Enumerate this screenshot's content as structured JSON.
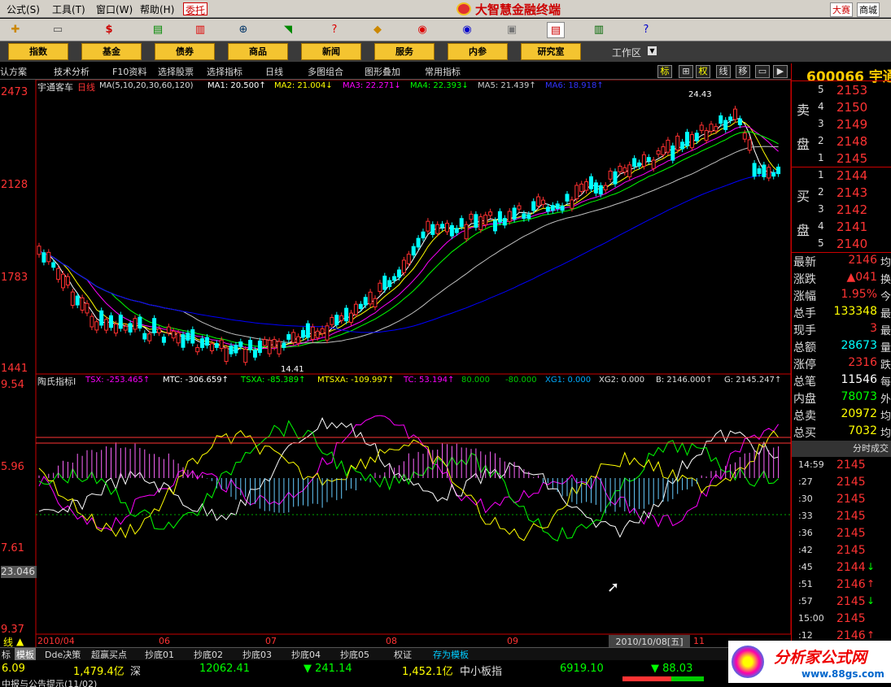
{
  "menu": {
    "items": [
      "公式(S)",
      "工具(T)",
      "窗口(W)",
      "帮助(H)"
    ],
    "entrust": "委托",
    "brand": "大智慧金融终端",
    "dasai": "大赛",
    "mall": "商城"
  },
  "nav": {
    "items": [
      "指数",
      "基金",
      "债券",
      "商品",
      "新闻",
      "服务",
      "内参",
      "研究室"
    ],
    "workarea": "工作区"
  },
  "funcbar": {
    "items": [
      "认方案",
      "技术分析",
      "F10资料",
      "选择股票",
      "选择指标",
      "日线",
      "多图组合",
      "图形叠加",
      "常用指标"
    ],
    "toggles": [
      "标",
      "权",
      "线",
      "移"
    ]
  },
  "main_chart": {
    "label": "宇通客车",
    "period": "日线",
    "ma_text": "MA(5,10,20,30,60,120)",
    "ma1": "MA1: 20.500↑",
    "ma2": "MA2: 21.004↓",
    "ma3": "MA3: 22.271↓",
    "ma4": "MA4: 22.393↓",
    "ma5": "MA5: 21.439↑",
    "ma6": "MA6: 18.918↑",
    "high_label": "24.43",
    "low_label": "14.41",
    "y_ticks": [
      "2473",
      "2128",
      "1783",
      "1441"
    ],
    "colors": {
      "up": "#ff3030",
      "down": "#00ffff",
      "ma1": "#ffffff",
      "ma2": "#ffff00",
      "ma3": "#ff00ff",
      "ma4": "#00ff00",
      "ma5": "#c0c0c0",
      "ma6": "#0000ff"
    }
  },
  "indicator": {
    "name": "陶氏指标I",
    "tsx": "TSX: -253.465↑",
    "mtc": "MTC: -306.659↑",
    "tsxa": "TSXA: -85.389↑",
    "mtsxa": "MTSXA: -109.997↑",
    "tc": "TC: 53.194↑",
    "c80": "80.000",
    "cm80": "-80.000",
    "xg1": "XG1: 0.000",
    "xg2": "XG2: 0.000",
    "b": "B: 2146.000↑",
    "g": "G: 2145.247↑",
    "y_ticks": [
      "9.54",
      "5.96",
      "7.61",
      "9.37"
    ],
    "cursor_value": "23.046"
  },
  "x_axis": [
    "2010/04",
    "06",
    "07",
    "08",
    "09",
    "11"
  ],
  "date_tip": "2010/10/08[五]",
  "line_label": "线",
  "quote": {
    "code": "600066 宇通",
    "sell_label": [
      "卖",
      "盘"
    ],
    "buy_label": [
      "买",
      "盘"
    ],
    "sell": [
      {
        "lvl": "5",
        "px": "2153"
      },
      {
        "lvl": "4",
        "px": "2150"
      },
      {
        "lvl": "3",
        "px": "2149"
      },
      {
        "lvl": "2",
        "px": "2148"
      },
      {
        "lvl": "1",
        "px": "2145"
      }
    ],
    "buy": [
      {
        "lvl": "1",
        "px": "2144"
      },
      {
        "lvl": "2",
        "px": "2143"
      },
      {
        "lvl": "3",
        "px": "2142"
      },
      {
        "lvl": "4",
        "px": "2141"
      },
      {
        "lvl": "5",
        "px": "2140"
      }
    ],
    "stats": [
      {
        "label": "最新",
        "value": "2146",
        "color": "#ff3333",
        "tail": "均"
      },
      {
        "label": "涨跌",
        "value": "▲041",
        "color": "#ff3333",
        "tail": "换"
      },
      {
        "label": "涨幅",
        "value": "1.95%",
        "color": "#ff3333",
        "tail": "今"
      },
      {
        "label": "总手",
        "value": "133348",
        "color": "#ffff00",
        "tail": "最"
      },
      {
        "label": "现手",
        "value": "3",
        "color": "#ff3333",
        "tail": "最"
      },
      {
        "label": "总额",
        "value": "28673",
        "color": "#00ffff",
        "tail": "量"
      },
      {
        "label": "涨停",
        "value": "2316",
        "color": "#ff3333",
        "tail": "跌"
      },
      {
        "label": "总笔",
        "value": "11546",
        "color": "#ffffff",
        "tail": "每"
      },
      {
        "label": "内盘",
        "value": "78073",
        "color": "#00ff00",
        "tail": "外"
      },
      {
        "label": "总卖",
        "value": "20972",
        "color": "#ffff00",
        "tail": "均"
      },
      {
        "label": "总买",
        "value": "7032",
        "color": "#ffff00",
        "tail": "均"
      }
    ],
    "ticks_title": "分时成交",
    "ticks": [
      {
        "t": "14:59",
        "p": "2145",
        "a": ""
      },
      {
        "t": ":27",
        "p": "2145",
        "a": ""
      },
      {
        "t": ":30",
        "p": "2145",
        "a": ""
      },
      {
        "t": ":33",
        "p": "2145",
        "a": ""
      },
      {
        "t": ":36",
        "p": "2145",
        "a": ""
      },
      {
        "t": ":42",
        "p": "2145",
        "a": ""
      },
      {
        "t": ":45",
        "p": "2144",
        "a": "↓"
      },
      {
        "t": ":51",
        "p": "2146",
        "a": "↑"
      },
      {
        "t": ":57",
        "p": "2145",
        "a": "↓"
      },
      {
        "t": "15:00",
        "p": "2145",
        "a": ""
      },
      {
        "t": ":12",
        "p": "2146",
        "a": "↑"
      }
    ]
  },
  "bottom_tabs": [
    "标",
    "模板",
    "Dde决策",
    "超赢买点",
    "抄底01",
    "抄底02",
    "抄底03",
    "抄底04",
    "抄底05",
    "权证",
    "存为模板"
  ],
  "statusbar": {
    "s1": "6.09",
    "s2": "1,479.4亿",
    "s3": "深",
    "s4": "12062.41",
    "s5": "▼ 241.14",
    "s6": "1,452.1亿",
    "s7": "中小板指",
    "s8": "6919.10",
    "s9": "▼ 88.03",
    "s10": "中报与公告提示(11/02)"
  },
  "logo": {
    "text": "分析家公式网",
    "url": "www.88gs.com"
  }
}
